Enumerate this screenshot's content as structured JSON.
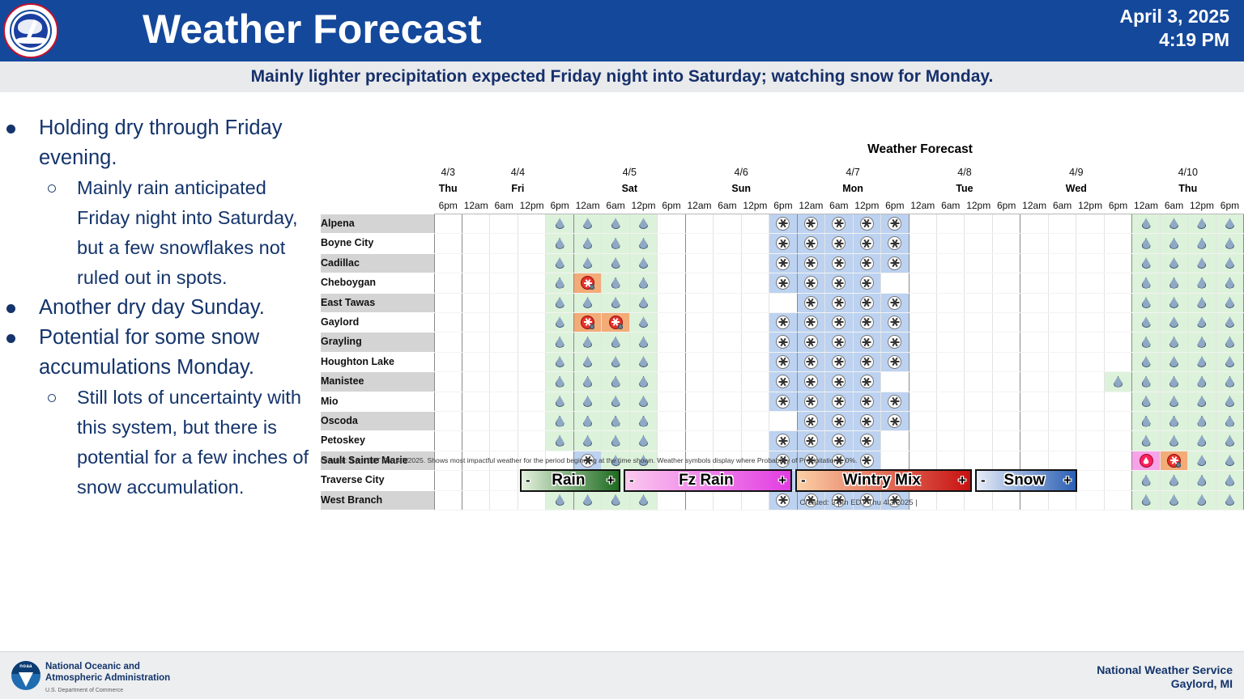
{
  "header": {
    "title": "Weather Forecast",
    "date": "April 3, 2025",
    "time": "4:19 PM",
    "logo_name": "national-weather-service-seal",
    "bg_color": "#14489b"
  },
  "subtitle": {
    "text": "Mainly lighter precipitation expected Friday night into Saturday; watching snow for Monday.",
    "text_color": "#16306b",
    "bg_color": "#e9eaec"
  },
  "bullets": [
    {
      "level": 1,
      "text": "Holding dry through Friday evening."
    },
    {
      "level": 2,
      "text": "Mainly rain anticipated Friday night into Saturday, but a few snowflakes not ruled out in spots."
    },
    {
      "level": 1,
      "text": "Another dry day Sunday."
    },
    {
      "level": 1,
      "text": "Potential for some snow accumulations Monday."
    },
    {
      "level": 2,
      "text": "Still lots of uncertainty with this system, but there is potential for a few inches of snow accumulation."
    }
  ],
  "chart_data": {
    "type": "heatmap",
    "title": "Weather Forecast",
    "footnote": "Created: 3 pm EDT Thu 4/3/2025. Shows most impactful weather for the period beginning at the time shown. Weather symbols display where Probability of Precipitation ≥ 0%.",
    "created": "Created: 3 pm EDT Thu 4/3/2025  |",
    "days": [
      {
        "date": "4/3",
        "day": "Thu",
        "hours": [
          "6pm"
        ]
      },
      {
        "date": "4/4",
        "day": "Fri",
        "hours": [
          "12am",
          "6am",
          "12pm",
          "6pm"
        ]
      },
      {
        "date": "4/5",
        "day": "Sat",
        "hours": [
          "12am",
          "6am",
          "12pm",
          "6pm"
        ]
      },
      {
        "date": "4/6",
        "day": "Sun",
        "hours": [
          "12am",
          "6am",
          "12pm",
          "6pm"
        ]
      },
      {
        "date": "4/7",
        "day": "Mon",
        "hours": [
          "12am",
          "6am",
          "12pm",
          "6pm"
        ]
      },
      {
        "date": "4/8",
        "day": "Tue",
        "hours": [
          "12am",
          "6am",
          "12pm",
          "6pm"
        ]
      },
      {
        "date": "4/9",
        "day": "Wed",
        "hours": [
          "12am",
          "6am",
          "12pm",
          "6pm"
        ]
      },
      {
        "date": "4/10",
        "day": "Thu",
        "hours": [
          "12am",
          "6am",
          "12pm",
          "6pm"
        ]
      }
    ],
    "categories": [
      "Alpena",
      "Boyne City",
      "Cadillac",
      "Cheboygan",
      "East Tawas",
      "Gaylord",
      "Grayling",
      "Houghton Lake",
      "Manistee",
      "Mio",
      "Oscoda",
      "Petoskey",
      "Sault Sainte Marie",
      "Traverse City",
      "West Branch"
    ],
    "symbol_legend": {
      "r": "rain",
      "s": "snow",
      "m": "wintry-mix",
      "f": "freezing-rain",
      "": "none"
    },
    "rows": [
      {
        "city": "Alpena",
        "cells": [
          "",
          "",
          "",
          "",
          "r",
          "r",
          "r",
          "r",
          "",
          "",
          "",
          "",
          "s",
          "s",
          "s",
          "s",
          "s",
          "",
          "",
          "",
          "",
          "",
          "",
          "",
          "",
          "r",
          "r",
          "r",
          "r"
        ]
      },
      {
        "city": "Boyne City",
        "cells": [
          "",
          "",
          "",
          "",
          "r",
          "r",
          "r",
          "r",
          "",
          "",
          "",
          "",
          "s",
          "s",
          "s",
          "s",
          "s",
          "",
          "",
          "",
          "",
          "",
          "",
          "",
          "",
          "r",
          "r",
          "r",
          "r"
        ]
      },
      {
        "city": "Cadillac",
        "cells": [
          "",
          "",
          "",
          "",
          "r",
          "r",
          "r",
          "r",
          "",
          "",
          "",
          "",
          "s",
          "s",
          "s",
          "s",
          "s",
          "",
          "",
          "",
          "",
          "",
          "",
          "",
          "",
          "r",
          "r",
          "r",
          "r"
        ]
      },
      {
        "city": "Cheboygan",
        "cells": [
          "",
          "",
          "",
          "",
          "r",
          "m",
          "r",
          "r",
          "",
          "",
          "",
          "",
          "s",
          "s",
          "s",
          "s",
          "",
          "",
          "",
          "",
          "",
          "",
          "",
          "",
          "",
          "r",
          "r",
          "r",
          "r"
        ]
      },
      {
        "city": "East Tawas",
        "cells": [
          "",
          "",
          "",
          "",
          "r",
          "r",
          "r",
          "r",
          "",
          "",
          "",
          "",
          "",
          "s",
          "s",
          "s",
          "s",
          "",
          "",
          "",
          "",
          "",
          "",
          "",
          "",
          "r",
          "r",
          "r",
          "r"
        ]
      },
      {
        "city": "Gaylord",
        "cells": [
          "",
          "",
          "",
          "",
          "r",
          "m",
          "m",
          "r",
          "",
          "",
          "",
          "",
          "s",
          "s",
          "s",
          "s",
          "s",
          "",
          "",
          "",
          "",
          "",
          "",
          "",
          "",
          "r",
          "r",
          "r",
          "r"
        ]
      },
      {
        "city": "Grayling",
        "cells": [
          "",
          "",
          "",
          "",
          "r",
          "r",
          "r",
          "r",
          "",
          "",
          "",
          "",
          "s",
          "s",
          "s",
          "s",
          "s",
          "",
          "",
          "",
          "",
          "",
          "",
          "",
          "",
          "r",
          "r",
          "r",
          "r"
        ]
      },
      {
        "city": "Houghton Lake",
        "cells": [
          "",
          "",
          "",
          "",
          "r",
          "r",
          "r",
          "r",
          "",
          "",
          "",
          "",
          "s",
          "s",
          "s",
          "s",
          "s",
          "",
          "",
          "",
          "",
          "",
          "",
          "",
          "",
          "r",
          "r",
          "r",
          "r"
        ]
      },
      {
        "city": "Manistee",
        "cells": [
          "",
          "",
          "",
          "",
          "r",
          "r",
          "r",
          "r",
          "",
          "",
          "",
          "",
          "s",
          "s",
          "s",
          "s",
          "",
          "",
          "",
          "",
          "",
          "",
          "",
          "",
          "r",
          "r",
          "r",
          "r",
          "r"
        ]
      },
      {
        "city": "Mio",
        "cells": [
          "",
          "",
          "",
          "",
          "r",
          "r",
          "r",
          "r",
          "",
          "",
          "",
          "",
          "s",
          "s",
          "s",
          "s",
          "s",
          "",
          "",
          "",
          "",
          "",
          "",
          "",
          "",
          "r",
          "r",
          "r",
          "r"
        ]
      },
      {
        "city": "Oscoda",
        "cells": [
          "",
          "",
          "",
          "",
          "r",
          "r",
          "r",
          "r",
          "",
          "",
          "",
          "",
          "",
          "s",
          "s",
          "s",
          "s",
          "",
          "",
          "",
          "",
          "",
          "",
          "",
          "",
          "r",
          "r",
          "r",
          "r"
        ]
      },
      {
        "city": "Petoskey",
        "cells": [
          "",
          "",
          "",
          "",
          "r",
          "r",
          "r",
          "r",
          "",
          "",
          "",
          "",
          "s",
          "s",
          "s",
          "s",
          "",
          "",
          "",
          "",
          "",
          "",
          "",
          "",
          "",
          "r",
          "r",
          "r",
          "r"
        ]
      },
      {
        "city": "Sault Sainte Marie",
        "cells": [
          "",
          "",
          "",
          "",
          "",
          "s",
          "r",
          "r",
          "",
          "",
          "",
          "",
          "s",
          "s",
          "s",
          "s",
          "",
          "",
          "",
          "",
          "",
          "",
          "",
          "",
          "",
          "f",
          "m",
          "r",
          "r"
        ]
      },
      {
        "city": "Traverse City",
        "cells": [
          "",
          "",
          "",
          "",
          "r",
          "r",
          "r",
          "r",
          "",
          "",
          "",
          "",
          "s",
          "s",
          "s",
          "s",
          "s",
          "",
          "",
          "",
          "",
          "",
          "",
          "",
          "",
          "r",
          "r",
          "r",
          "r"
        ]
      },
      {
        "city": "West Branch",
        "cells": [
          "",
          "",
          "",
          "",
          "r",
          "r",
          "r",
          "r",
          "",
          "",
          "",
          "",
          "s",
          "s",
          "s",
          "s",
          "s",
          "",
          "",
          "",
          "",
          "",
          "",
          "",
          "",
          "r",
          "r",
          "r",
          "r"
        ]
      }
    ]
  },
  "legend": [
    {
      "name": "rain",
      "minus": "-",
      "label": "Rain",
      "plus": "+",
      "grad_from": "#e4f1dd",
      "grad_to": "#1d6b1f"
    },
    {
      "name": "fz-rain",
      "minus": "-",
      "label": "Fz Rain",
      "plus": "+",
      "grad_from": "#fbc9ef",
      "grad_to": "#e23ce2"
    },
    {
      "name": "wintry-mix",
      "minus": "-",
      "label": "Wintry Mix",
      "plus": "+",
      "grad_from": "#fbd0a6",
      "grad_to": "#c81111"
    },
    {
      "name": "snow",
      "minus": "-",
      "label": "Snow",
      "plus": "+",
      "grad_from": "#e6ecf8",
      "grad_to": "#2b5fb4"
    }
  ],
  "footer": {
    "noaa_line1": "National Oceanic and",
    "noaa_line2": "Atmospheric Administration",
    "noaa_sub": "U.S. Department of Commerce",
    "noaa_mark": "noaa",
    "office_line1": "National Weather Service",
    "office_line2": "Gaylord, MI"
  }
}
